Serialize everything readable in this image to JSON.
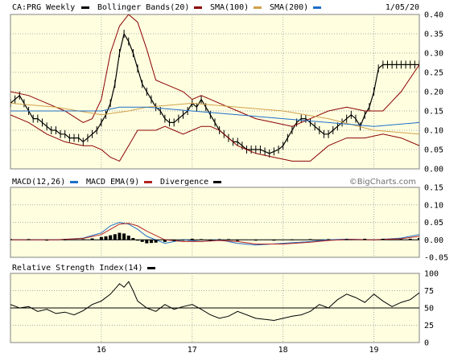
{
  "colors": {
    "background": "#ffffe0",
    "frame": "#808080",
    "grid": "#a9a9a9",
    "price": "#000000",
    "bollinger": "#8b0000",
    "sma100": "#d2a04b",
    "sma200": "#1e6ec8",
    "macd": "#1e6ec8",
    "macd_ema": "#b22222",
    "divergence": "#000000",
    "rsi": "#000000"
  },
  "chart_data": [
    {
      "id": "price",
      "type": "line",
      "title": "CA:PRG Weekly",
      "date_label": "1/05/20",
      "legend": [
        {
          "label": "Bollinger Bands(20)",
          "color": "#000000"
        },
        {
          "label": "SMA(100)",
          "color": "#8b0000"
        },
        {
          "label": "SMA(200)",
          "color": "#d2a04b"
        }
      ],
      "legend_trailing_swatch": "#1e6ec8",
      "ylim": [
        0,
        0.4
      ],
      "y_ticks": [
        "0.00",
        "0.05",
        "0.10",
        "0.15",
        "0.20",
        "0.25",
        "0.30",
        "0.35",
        "0.40"
      ],
      "x_ticks": [
        "16",
        "17",
        "18",
        "19"
      ],
      "x_tick_positions": [
        0.5,
        1.5,
        2.5,
        3.5
      ],
      "xlim": [
        -0.5,
        4.0
      ],
      "series": [
        {
          "role": "price",
          "x": [
            -0.5,
            -0.45,
            -0.4,
            -0.35,
            -0.3,
            -0.25,
            -0.2,
            -0.15,
            -0.1,
            -0.05,
            0.0,
            0.05,
            0.1,
            0.15,
            0.2,
            0.25,
            0.3,
            0.35,
            0.4,
            0.45,
            0.5,
            0.55,
            0.6,
            0.65,
            0.7,
            0.75,
            0.8,
            0.85,
            0.9,
            0.95,
            1.0,
            1.05,
            1.1,
            1.15,
            1.2,
            1.25,
            1.3,
            1.35,
            1.4,
            1.45,
            1.5,
            1.55,
            1.6,
            1.65,
            1.7,
            1.75,
            1.8,
            1.85,
            1.9,
            1.95,
            2.0,
            2.05,
            2.1,
            2.15,
            2.2,
            2.25,
            2.3,
            2.35,
            2.4,
            2.45,
            2.5,
            2.55,
            2.6,
            2.65,
            2.7,
            2.75,
            2.8,
            2.85,
            2.9,
            2.95,
            3.0,
            3.05,
            3.1,
            3.15,
            3.2,
            3.25,
            3.3,
            3.35,
            3.4,
            3.45,
            3.5,
            3.55,
            3.6,
            3.65,
            3.7,
            3.75,
            3.8,
            3.85,
            3.9,
            3.95,
            4.0
          ],
          "y": [
            0.17,
            0.18,
            0.19,
            0.17,
            0.15,
            0.13,
            0.13,
            0.12,
            0.11,
            0.1,
            0.1,
            0.09,
            0.09,
            0.08,
            0.08,
            0.08,
            0.07,
            0.08,
            0.09,
            0.1,
            0.12,
            0.14,
            0.17,
            0.22,
            0.3,
            0.35,
            0.33,
            0.3,
            0.26,
            0.22,
            0.2,
            0.18,
            0.16,
            0.15,
            0.13,
            0.12,
            0.12,
            0.13,
            0.14,
            0.15,
            0.17,
            0.16,
            0.18,
            0.16,
            0.14,
            0.12,
            0.1,
            0.09,
            0.08,
            0.07,
            0.07,
            0.06,
            0.05,
            0.05,
            0.05,
            0.05,
            0.045,
            0.04,
            0.045,
            0.05,
            0.06,
            0.08,
            0.1,
            0.12,
            0.13,
            0.13,
            0.12,
            0.11,
            0.1,
            0.09,
            0.09,
            0.1,
            0.11,
            0.12,
            0.13,
            0.14,
            0.13,
            0.11,
            0.14,
            0.16,
            0.2,
            0.26,
            0.27,
            0.27,
            0.27,
            0.27,
            0.27,
            0.27,
            0.27,
            0.27,
            0.27
          ]
        },
        {
          "role": "bollinger_upper",
          "x": [
            -0.5,
            -0.3,
            -0.1,
            0.1,
            0.3,
            0.4,
            0.5,
            0.6,
            0.7,
            0.8,
            0.9,
            1.0,
            1.1,
            1.2,
            1.3,
            1.4,
            1.5,
            1.6,
            1.7,
            1.8,
            2.0,
            2.2,
            2.4,
            2.6,
            2.8,
            3.0,
            3.2,
            3.4,
            3.6,
            3.8,
            4.0
          ],
          "y": [
            0.2,
            0.19,
            0.17,
            0.15,
            0.12,
            0.13,
            0.18,
            0.3,
            0.37,
            0.4,
            0.38,
            0.31,
            0.23,
            0.22,
            0.21,
            0.2,
            0.18,
            0.19,
            0.18,
            0.17,
            0.15,
            0.13,
            0.12,
            0.11,
            0.13,
            0.15,
            0.16,
            0.15,
            0.15,
            0.2,
            0.27
          ]
        },
        {
          "role": "bollinger_lower",
          "x": [
            -0.5,
            -0.3,
            -0.1,
            0.1,
            0.3,
            0.4,
            0.5,
            0.6,
            0.7,
            0.8,
            0.9,
            1.0,
            1.1,
            1.2,
            1.3,
            1.4,
            1.5,
            1.6,
            1.7,
            1.8,
            2.0,
            2.2,
            2.4,
            2.6,
            2.8,
            3.0,
            3.2,
            3.4,
            3.6,
            3.8,
            4.0
          ],
          "y": [
            0.14,
            0.12,
            0.09,
            0.07,
            0.06,
            0.06,
            0.05,
            0.03,
            0.02,
            0.06,
            0.1,
            0.1,
            0.1,
            0.11,
            0.1,
            0.09,
            0.1,
            0.11,
            0.11,
            0.1,
            0.06,
            0.04,
            0.03,
            0.02,
            0.02,
            0.06,
            0.08,
            0.08,
            0.09,
            0.08,
            0.06
          ]
        },
        {
          "role": "sma100",
          "x": [
            -0.5,
            0.0,
            0.5,
            0.8,
            1.0,
            1.5,
            2.0,
            2.5,
            3.0,
            3.5,
            4.0
          ],
          "y": [
            0.17,
            0.16,
            0.14,
            0.15,
            0.16,
            0.17,
            0.16,
            0.15,
            0.13,
            0.1,
            0.09
          ]
        },
        {
          "role": "sma200",
          "x": [
            -0.5,
            0.0,
            0.5,
            0.7,
            1.0,
            1.5,
            2.0,
            2.5,
            3.0,
            3.5,
            4.0
          ],
          "y": [
            0.15,
            0.15,
            0.15,
            0.16,
            0.16,
            0.15,
            0.14,
            0.13,
            0.12,
            0.11,
            0.12
          ]
        }
      ]
    },
    {
      "id": "macd",
      "type": "line",
      "legend": [
        {
          "label": "MACD(12,26)",
          "color": "#000000"
        },
        {
          "label": "MACD EMA(9)",
          "color": "#1e6ec8"
        },
        {
          "label": "Divergence",
          "color": "#b22222"
        }
      ],
      "legend_trailing_swatch": "#000000",
      "watermark": "©BigCharts.com",
      "ylim": [
        -0.05,
        0.15
      ],
      "y_ticks": [
        "0.15",
        "0.10",
        "0.05",
        "0.00",
        "-0.05"
      ],
      "series": [
        {
          "role": "macd",
          "x": [
            -0.5,
            0.0,
            0.3,
            0.5,
            0.6,
            0.7,
            0.8,
            0.9,
            1.0,
            1.2,
            1.4,
            1.6,
            1.8,
            2.0,
            2.2,
            2.5,
            2.8,
            3.0,
            3.2,
            3.5,
            3.8,
            4.0
          ],
          "y": [
            0.0,
            0.0,
            0.005,
            0.02,
            0.04,
            0.05,
            0.045,
            0.03,
            0.01,
            -0.01,
            0.0,
            -0.005,
            0.0,
            -0.01,
            -0.015,
            -0.01,
            -0.005,
            0.0,
            0.002,
            0.0,
            0.005,
            0.015
          ]
        },
        {
          "role": "macd_ema",
          "x": [
            -0.5,
            0.0,
            0.3,
            0.5,
            0.6,
            0.7,
            0.8,
            0.9,
            1.0,
            1.2,
            1.4,
            1.6,
            1.8,
            2.0,
            2.2,
            2.5,
            2.8,
            3.0,
            3.2,
            3.5,
            3.8,
            4.0
          ],
          "y": [
            0.0,
            0.0,
            0.004,
            0.015,
            0.03,
            0.045,
            0.047,
            0.04,
            0.025,
            0.0,
            -0.005,
            -0.005,
            -0.002,
            -0.005,
            -0.012,
            -0.012,
            -0.007,
            -0.002,
            0.001,
            0.0,
            0.003,
            0.01
          ]
        },
        {
          "role": "divergence",
          "x": [
            -0.5,
            -0.3,
            -0.1,
            0.1,
            0.3,
            0.4,
            0.5,
            0.55,
            0.6,
            0.65,
            0.7,
            0.75,
            0.8,
            0.85,
            0.9,
            0.95,
            1.0,
            1.05,
            1.1,
            1.2,
            1.3,
            1.4,
            1.5,
            1.6,
            1.7,
            1.8,
            1.9,
            2.0,
            2.2,
            2.4,
            2.6,
            2.8,
            3.0,
            3.2,
            3.4,
            3.6,
            3.8,
            3.9,
            4.0
          ],
          "y": [
            0.002,
            0.002,
            -0.001,
            0.001,
            0.002,
            0.004,
            0.008,
            0.01,
            0.013,
            0.016,
            0.02,
            0.018,
            0.012,
            0.005,
            0.0,
            -0.006,
            -0.01,
            -0.009,
            -0.008,
            -0.006,
            -0.003,
            -0.002,
            0.003,
            0.002,
            -0.002,
            0.002,
            0.002,
            -0.003,
            -0.002,
            -0.002,
            0.001,
            0.002,
            0.002,
            0.002,
            0.003,
            0.003,
            0.002,
            0.003,
            0.005
          ]
        }
      ]
    },
    {
      "id": "rsi",
      "type": "line",
      "legend": [
        {
          "label": "Relative Strength Index(14)",
          "color": "#000000"
        }
      ],
      "ylim": [
        0,
        100
      ],
      "y_ticks": [
        "100",
        "75",
        "50",
        "25",
        "0"
      ],
      "reference_line": 50,
      "series": [
        {
          "role": "rsi",
          "x": [
            -0.5,
            -0.4,
            -0.3,
            -0.2,
            -0.1,
            0.0,
            0.1,
            0.2,
            0.3,
            0.4,
            0.5,
            0.6,
            0.7,
            0.75,
            0.8,
            0.85,
            0.9,
            1.0,
            1.1,
            1.2,
            1.3,
            1.4,
            1.5,
            1.6,
            1.7,
            1.8,
            1.9,
            2.0,
            2.2,
            2.4,
            2.6,
            2.7,
            2.8,
            2.9,
            3.0,
            3.1,
            3.2,
            3.3,
            3.4,
            3.5,
            3.6,
            3.7,
            3.8,
            3.9,
            4.0
          ],
          "y": [
            55,
            50,
            52,
            45,
            48,
            42,
            44,
            40,
            46,
            55,
            60,
            70,
            85,
            80,
            88,
            75,
            60,
            50,
            45,
            55,
            48,
            52,
            55,
            48,
            40,
            35,
            38,
            45,
            35,
            32,
            38,
            40,
            45,
            55,
            50,
            62,
            70,
            65,
            58,
            70,
            60,
            52,
            58,
            62,
            72
          ]
        }
      ]
    }
  ]
}
